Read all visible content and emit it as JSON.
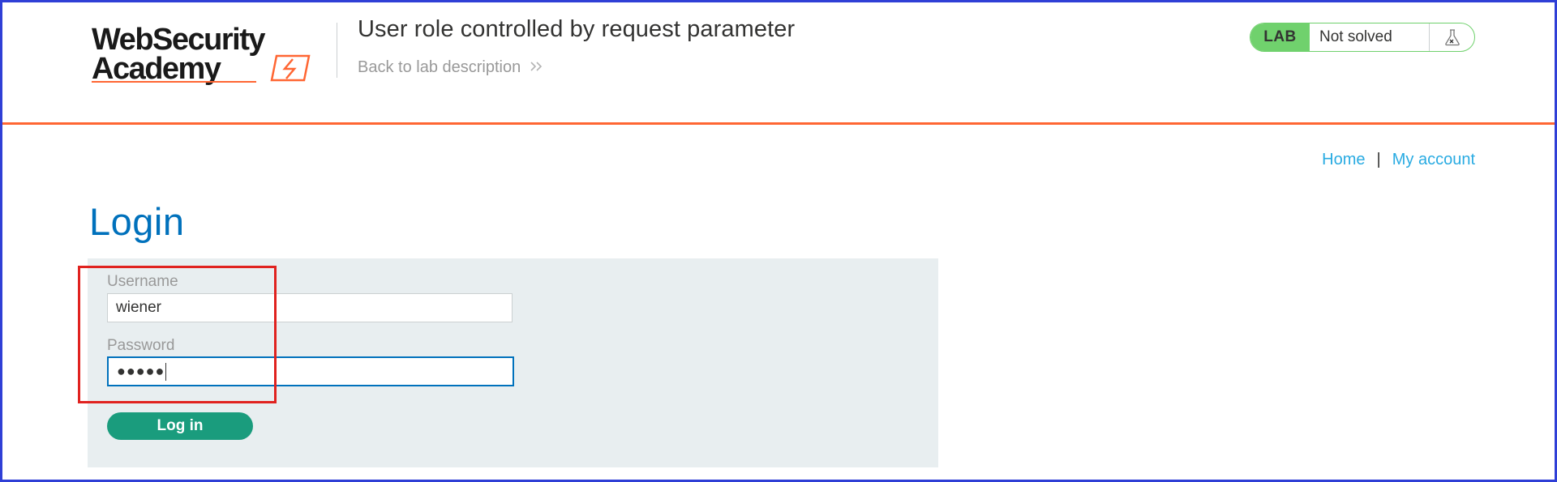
{
  "header": {
    "logo_line1": "WebSecurity",
    "logo_line2": "Academy",
    "lab_title": "User role controlled by request parameter",
    "back_link": "Back to lab description",
    "back_chevron": "»",
    "lab_badge": "LAB",
    "status": "Not solved",
    "flask_icon": "flask-icon"
  },
  "nav": {
    "home": "Home",
    "separator": "|",
    "my_account": "My account"
  },
  "page": {
    "title": "Login"
  },
  "form": {
    "username_label": "Username",
    "username_value": "wiener",
    "password_label": "Password",
    "password_value": "●●●●●",
    "submit_label": "Log in"
  },
  "colors": {
    "accent_orange": "#ff6633",
    "title_blue": "#0071bc",
    "link_blue": "#29abe2",
    "button_green": "#1a9c7d",
    "status_green": "#70d16d",
    "annotation_red": "#e0221f",
    "frame_blue": "#2f3fd6"
  }
}
